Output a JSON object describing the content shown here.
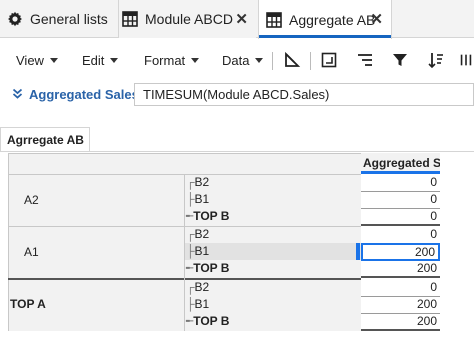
{
  "tabs": [
    {
      "label": "General lists",
      "icon": "gear-icon",
      "active": false,
      "closable": false
    },
    {
      "label": "Module ABCD",
      "icon": "grid-icon",
      "active": false,
      "closable": true
    },
    {
      "label": "Aggregate AB",
      "icon": "grid-icon",
      "active": true,
      "closable": true
    }
  ],
  "menus": [
    "View",
    "Edit",
    "Format",
    "Data"
  ],
  "toolbar_icons": [
    "triangle-ruler-icon",
    "export-box-icon",
    "align-lines-icon",
    "filter-icon",
    "sort-icon",
    "pivot-columns-icon"
  ],
  "formula": {
    "name": "Aggregated Sales",
    "expression": "TIMESUM(Module ABCD.Sales)"
  },
  "section_tab": "Agrregate AB",
  "grid": {
    "column_header": "Aggregated Sa",
    "groups": [
      {
        "label": "A2",
        "rows": [
          {
            "label": "B2",
            "value": "0"
          },
          {
            "label": "B1",
            "value": "0"
          },
          {
            "label": "TOP B",
            "value": "0"
          }
        ]
      },
      {
        "label": "A1",
        "rows": [
          {
            "label": "B2",
            "value": "0"
          },
          {
            "label": "B1",
            "value": "200"
          },
          {
            "label": "TOP B",
            "value": "200"
          }
        ]
      },
      {
        "label": "TOP A",
        "rows": [
          {
            "label": "B2",
            "value": "0"
          },
          {
            "label": "B1",
            "value": "200"
          },
          {
            "label": "TOP B",
            "value": "200"
          }
        ]
      }
    ]
  },
  "colors": {
    "accent": "#1a73e8",
    "formula_name": "#2a63a8"
  }
}
